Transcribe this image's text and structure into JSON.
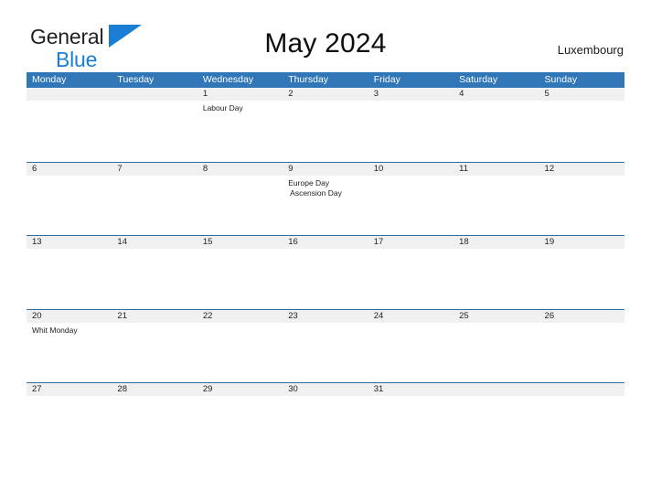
{
  "brand": {
    "name_part1": "General",
    "name_part2": "Blue",
    "flag_color": "#1a7fd4",
    "text_color": "#231f20"
  },
  "header": {
    "title": "May 2024",
    "region": "Luxembourg",
    "accent_color": "#3176b6",
    "rule_color": "#2e6da4",
    "date_strip_color": "#f0f0f0"
  },
  "calendar": {
    "weekdays": [
      "Monday",
      "Tuesday",
      "Wednesday",
      "Thursday",
      "Friday",
      "Saturday",
      "Sunday"
    ],
    "weeks": [
      {
        "days": [
          {
            "date": "",
            "events": []
          },
          {
            "date": "",
            "events": []
          },
          {
            "date": "1",
            "events": [
              "Labour Day"
            ]
          },
          {
            "date": "2",
            "events": []
          },
          {
            "date": "3",
            "events": []
          },
          {
            "date": "4",
            "events": []
          },
          {
            "date": "5",
            "events": []
          }
        ]
      },
      {
        "days": [
          {
            "date": "6",
            "events": []
          },
          {
            "date": "7",
            "events": []
          },
          {
            "date": "8",
            "events": []
          },
          {
            "date": "9",
            "events": [
              "Europe Day",
              " Ascension Day"
            ]
          },
          {
            "date": "10",
            "events": []
          },
          {
            "date": "11",
            "events": []
          },
          {
            "date": "12",
            "events": []
          }
        ]
      },
      {
        "days": [
          {
            "date": "13",
            "events": []
          },
          {
            "date": "14",
            "events": []
          },
          {
            "date": "15",
            "events": []
          },
          {
            "date": "16",
            "events": []
          },
          {
            "date": "17",
            "events": []
          },
          {
            "date": "18",
            "events": []
          },
          {
            "date": "19",
            "events": []
          }
        ]
      },
      {
        "days": [
          {
            "date": "20",
            "events": [
              "Whit Monday"
            ]
          },
          {
            "date": "21",
            "events": []
          },
          {
            "date": "22",
            "events": []
          },
          {
            "date": "23",
            "events": []
          },
          {
            "date": "24",
            "events": []
          },
          {
            "date": "25",
            "events": []
          },
          {
            "date": "26",
            "events": []
          }
        ]
      },
      {
        "days": [
          {
            "date": "27",
            "events": []
          },
          {
            "date": "28",
            "events": []
          },
          {
            "date": "29",
            "events": []
          },
          {
            "date": "30",
            "events": []
          },
          {
            "date": "31",
            "events": []
          },
          {
            "date": "",
            "events": []
          },
          {
            "date": "",
            "events": []
          }
        ]
      }
    ]
  }
}
